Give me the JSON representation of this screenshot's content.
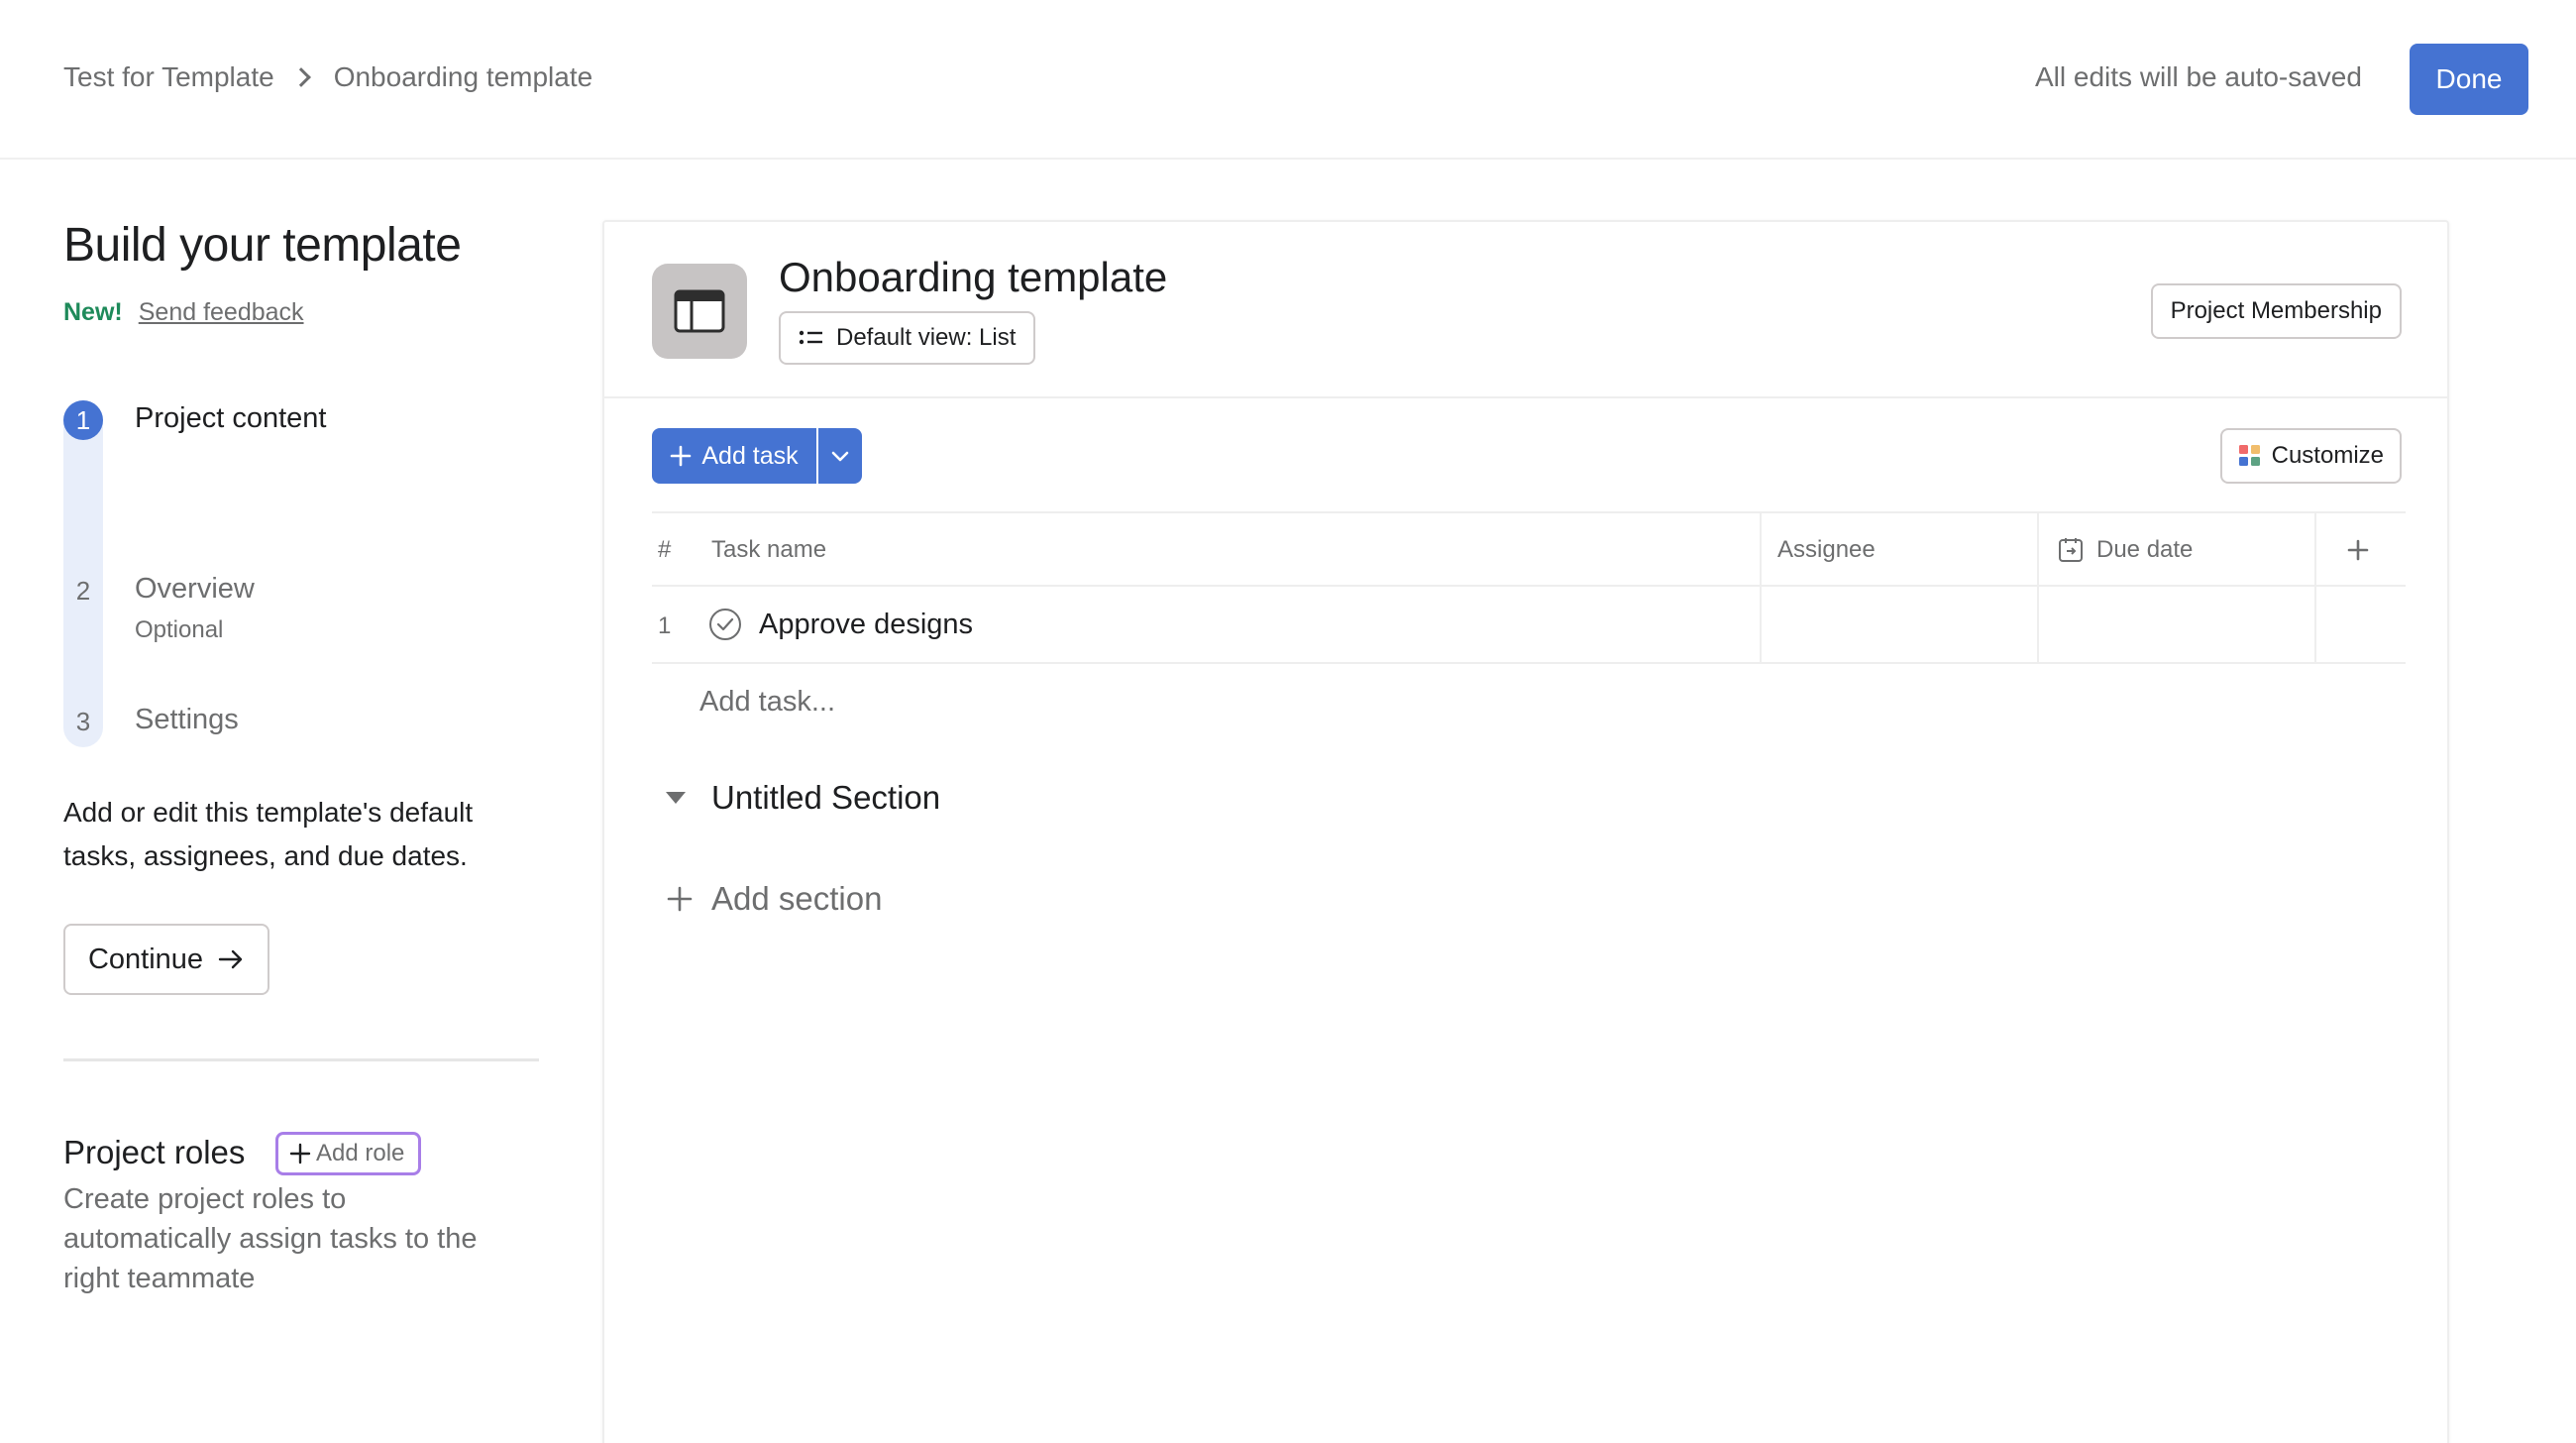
{
  "header": {
    "breadcrumb": [
      "Test for Template",
      "Onboarding template"
    ],
    "autosave_text": "All edits will be auto-saved",
    "done_label": "Done"
  },
  "left_panel": {
    "title": "Build your template",
    "new_tag": "New!",
    "feedback_link": "Send feedback",
    "steps": [
      {
        "number": "1",
        "label": "Project content",
        "sublabel": "",
        "active": true
      },
      {
        "number": "2",
        "label": "Overview",
        "sublabel": "Optional",
        "active": false
      },
      {
        "number": "3",
        "label": "Settings",
        "sublabel": "",
        "active": false
      }
    ],
    "description": "Add or edit this template's default tasks, assignees, and due dates.",
    "continue_label": "Continue",
    "roles_title": "Project roles",
    "add_role_label": "Add role",
    "roles_description": "Create project roles to automatically assign tasks to the right teammate"
  },
  "project": {
    "title": "Onboarding template",
    "default_view_label": "Default view: List",
    "membership_label": "Project Membership",
    "add_task_label": "Add task",
    "customize_label": "Customize",
    "columns": {
      "number": "#",
      "task_name": "Task name",
      "assignee": "Assignee",
      "due_date": "Due date"
    },
    "tasks": [
      {
        "number": "1",
        "name": "Approve designs",
        "assignee": "",
        "due_date": ""
      }
    ],
    "add_task_inline": "Add task...",
    "section_title": "Untitled Section",
    "add_section_label": "Add section"
  },
  "colors": {
    "primary": "#4573d2",
    "new_green": "#1e8a5a",
    "add_role_border": "#a87ee8",
    "step_rail": "#e8eefa"
  },
  "icons": [
    "chevron-right-icon",
    "arrow-right-icon",
    "plus-icon",
    "project-template-icon",
    "list-icon",
    "chevron-down-icon",
    "customize-grid-icon",
    "calendar-icon",
    "check-circle-icon",
    "triangle-down-icon"
  ]
}
